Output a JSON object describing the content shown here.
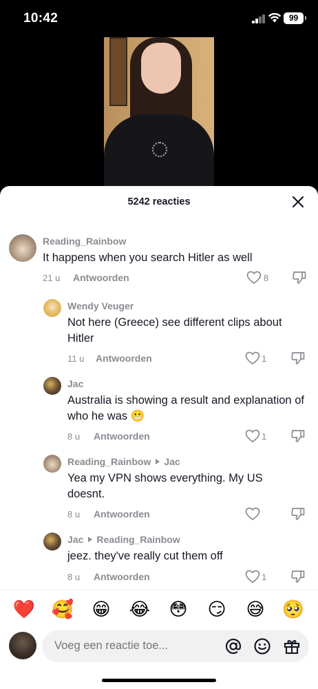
{
  "status_bar": {
    "time": "10:42",
    "battery": "99"
  },
  "sheet": {
    "title": "5242 reacties"
  },
  "comments": [
    {
      "user": "Reading_Rainbow",
      "reply_to": "",
      "text": "It happens when you search Hitler as well",
      "age": "21 u",
      "reply_label": "Antwoorden",
      "likes": "8"
    },
    {
      "user": "Wendy Veuger",
      "reply_to": "",
      "text": "Not here (Greece) see different clips about Hitler",
      "age": "11 u",
      "reply_label": "Antwoorden",
      "likes": "1"
    },
    {
      "user": "Jac",
      "reply_to": "",
      "text": "Australia is showing a result and explanation of who he was 😬",
      "age": "8 u",
      "reply_label": "Antwoorden",
      "likes": "1"
    },
    {
      "user": "Reading_Rainbow",
      "reply_to": "Jac",
      "text": "Yea my VPN shows everything. My US doesnt.",
      "age": "8 u",
      "reply_label": "Antwoorden",
      "likes": ""
    },
    {
      "user": "Jac",
      "reply_to": "Reading_Rainbow",
      "text": "jeez. they've really cut them off",
      "age": "8 u",
      "reply_label": "Antwoorden",
      "likes": "1"
    }
  ],
  "emoji_bar": [
    "❤️",
    "🥰",
    "😁",
    "😂",
    "😳",
    "😏",
    "😅",
    "🥺"
  ],
  "composer": {
    "placeholder": "Voeg een reactie toe..."
  },
  "icons": {
    "like": "heart-outline-icon",
    "dislike": "thumbs-down-icon",
    "close": "close-icon",
    "mention": "at-sign-icon",
    "emoji": "smiley-icon",
    "gift": "gift-icon"
  },
  "colors": {
    "text": "#161823",
    "muted": "#8a8b91",
    "sheet": "#ffffff"
  }
}
